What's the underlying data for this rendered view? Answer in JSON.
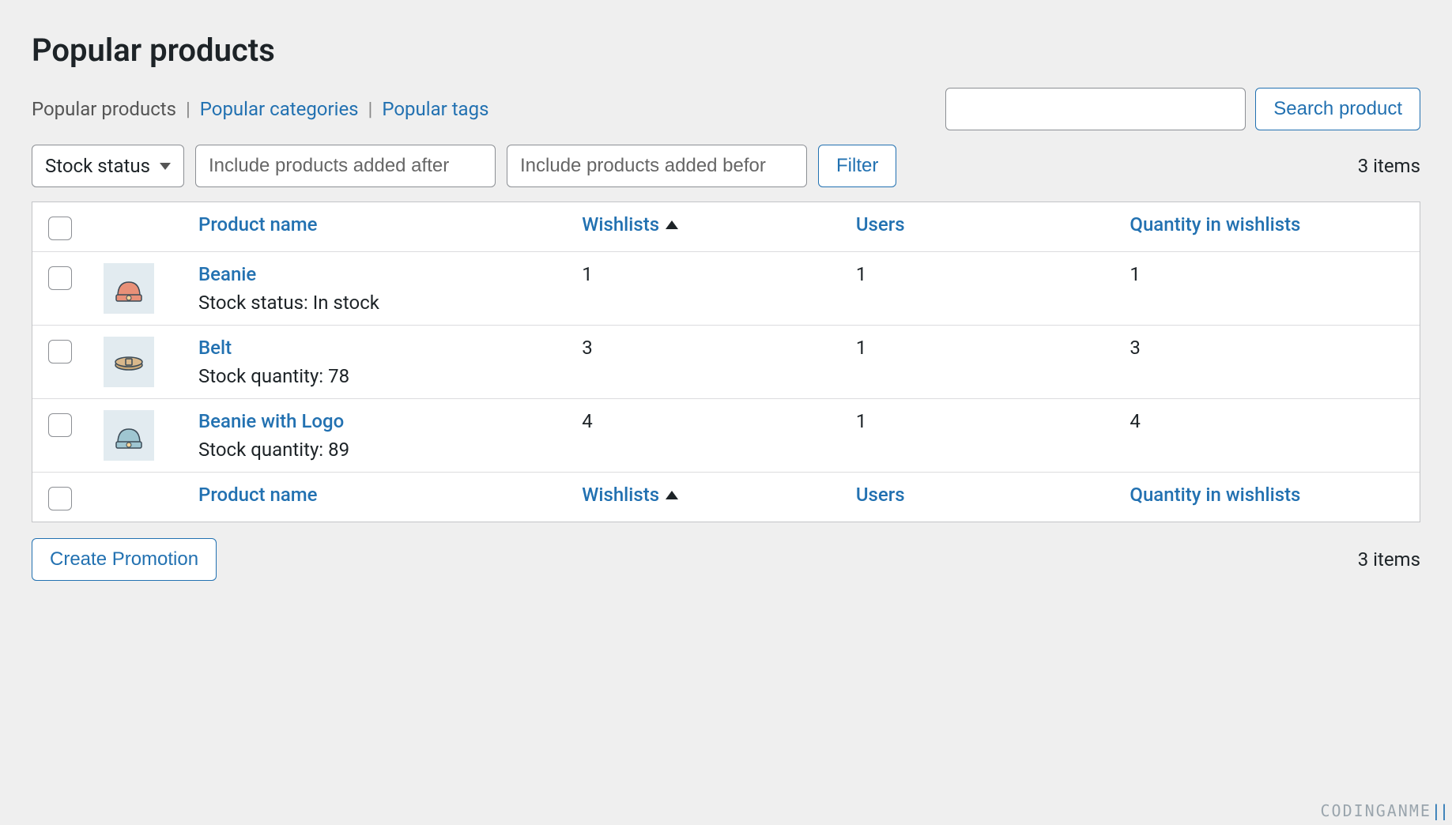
{
  "page_title": "Popular products",
  "breadcrumbs": {
    "current": "Popular products",
    "link_categories": "Popular categories",
    "link_tags": "Popular tags"
  },
  "search": {
    "value": "",
    "button_label": "Search product"
  },
  "filters": {
    "stock_status_label": "Stock status",
    "added_after_placeholder": "Include products added after",
    "added_before_placeholder": "Include products added befor",
    "filter_button": "Filter"
  },
  "item_count": "3 items",
  "columns": {
    "product_name": "Product name",
    "wishlists": "Wishlists",
    "users": "Users",
    "quantity": "Quantity in wishlists"
  },
  "rows": [
    {
      "name": "Beanie",
      "stock_line": "Stock status: In stock",
      "wishlists": "1",
      "users": "1",
      "quantity": "1",
      "icon": "beanie-orange"
    },
    {
      "name": "Belt",
      "stock_line": "Stock quantity: 78",
      "wishlists": "3",
      "users": "1",
      "quantity": "3",
      "icon": "belt"
    },
    {
      "name": "Beanie with Logo",
      "stock_line": "Stock quantity: 89",
      "wishlists": "4",
      "users": "1",
      "quantity": "4",
      "icon": "beanie-blue"
    }
  ],
  "footer_button": "Create Promotion",
  "watermark": "CODINGANME"
}
